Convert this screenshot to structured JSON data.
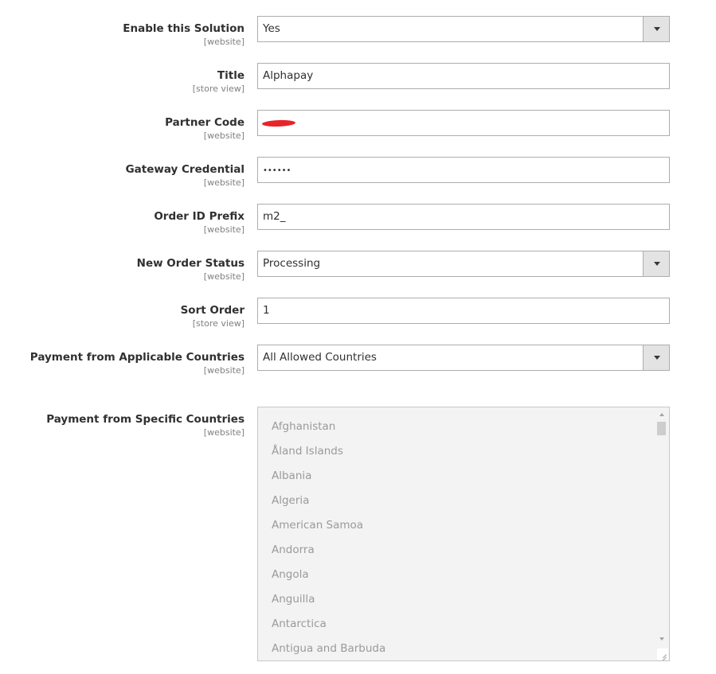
{
  "fields": {
    "enable": {
      "label": "Enable this Solution",
      "scope": "[website]",
      "value": "Yes"
    },
    "title": {
      "label": "Title",
      "scope": "[store view]",
      "value": "Alphapay"
    },
    "partner_code": {
      "label": "Partner Code",
      "scope": "[website]",
      "value": ""
    },
    "gateway_credential": {
      "label": "Gateway Credential",
      "scope": "[website]",
      "value": "••••••"
    },
    "order_id_prefix": {
      "label": "Order ID Prefix",
      "scope": "[website]",
      "value": "m2_"
    },
    "new_order_status": {
      "label": "New Order Status",
      "scope": "[website]",
      "value": "Processing"
    },
    "sort_order": {
      "label": "Sort Order",
      "scope": "[store view]",
      "value": "1"
    },
    "applicable_countries": {
      "label": "Payment from Applicable Countries",
      "scope": "[website]",
      "value": "All Allowed Countries"
    },
    "specific_countries": {
      "label": "Payment from Specific Countries",
      "scope": "[website]",
      "options": [
        "Afghanistan",
        "Åland Islands",
        "Albania",
        "Algeria",
        "American Samoa",
        "Andorra",
        "Angola",
        "Anguilla",
        "Antarctica",
        "Antigua and Barbuda"
      ]
    }
  },
  "colors": {
    "redaction": "#e8242a",
    "disabled_bg": "#f3f3f3",
    "disabled_text": "#9a9a9a",
    "select_button_bg": "#e3e3e3"
  }
}
